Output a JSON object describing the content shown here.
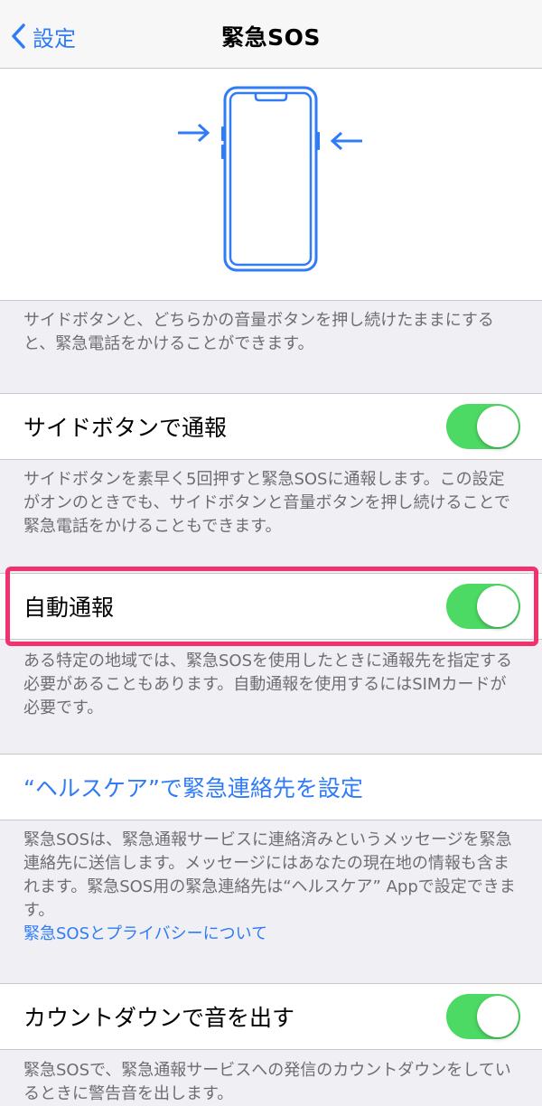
{
  "nav": {
    "back_label": "設定",
    "title": "緊急SOS"
  },
  "illustration": {
    "description_text": "サイドボタンと、どちらかの音量ボタンを押し続けたままにすると、緊急電話をかけることができます。"
  },
  "settings": {
    "side_button_call": {
      "label": "サイドボタンで通報",
      "enabled": true,
      "footer": "サイドボタンを素早く5回押すと緊急SOSに通報します。この設定がオンのときでも、サイドボタンと音量ボタンを押し続けることで緊急電話をかけることもできます。"
    },
    "auto_call": {
      "label": "自動通報",
      "enabled": true,
      "footer": "ある特定の地域では、緊急SOSを使用したときに通報先を指定する必要があることもあります。自動通報を使用するにはSIMカードが必要です。"
    },
    "health_contacts": {
      "link_label": "“ヘルスケア”で緊急連絡先を設定",
      "footer": "緊急SOSは、緊急通報サービスに連絡済みというメッセージを緊急連絡先に送信します。メッセージにはあなたの現在地の情報も含まれます。緊急SOS用の緊急連絡先は“ヘルスケア” Appで設定できます。",
      "privacy_link": "緊急SOSとプライバシーについて"
    },
    "countdown_sound": {
      "label": "カウントダウンで音を出す",
      "enabled": true,
      "footer": "緊急SOSで、緊急通報サービスへの発信のカウントダウンをしているときに警告音を出します。"
    }
  },
  "colors": {
    "accent": "#2f7cf6",
    "toggle_on": "#4cd964",
    "highlight": "#f0326e",
    "background": "#efeff4"
  }
}
